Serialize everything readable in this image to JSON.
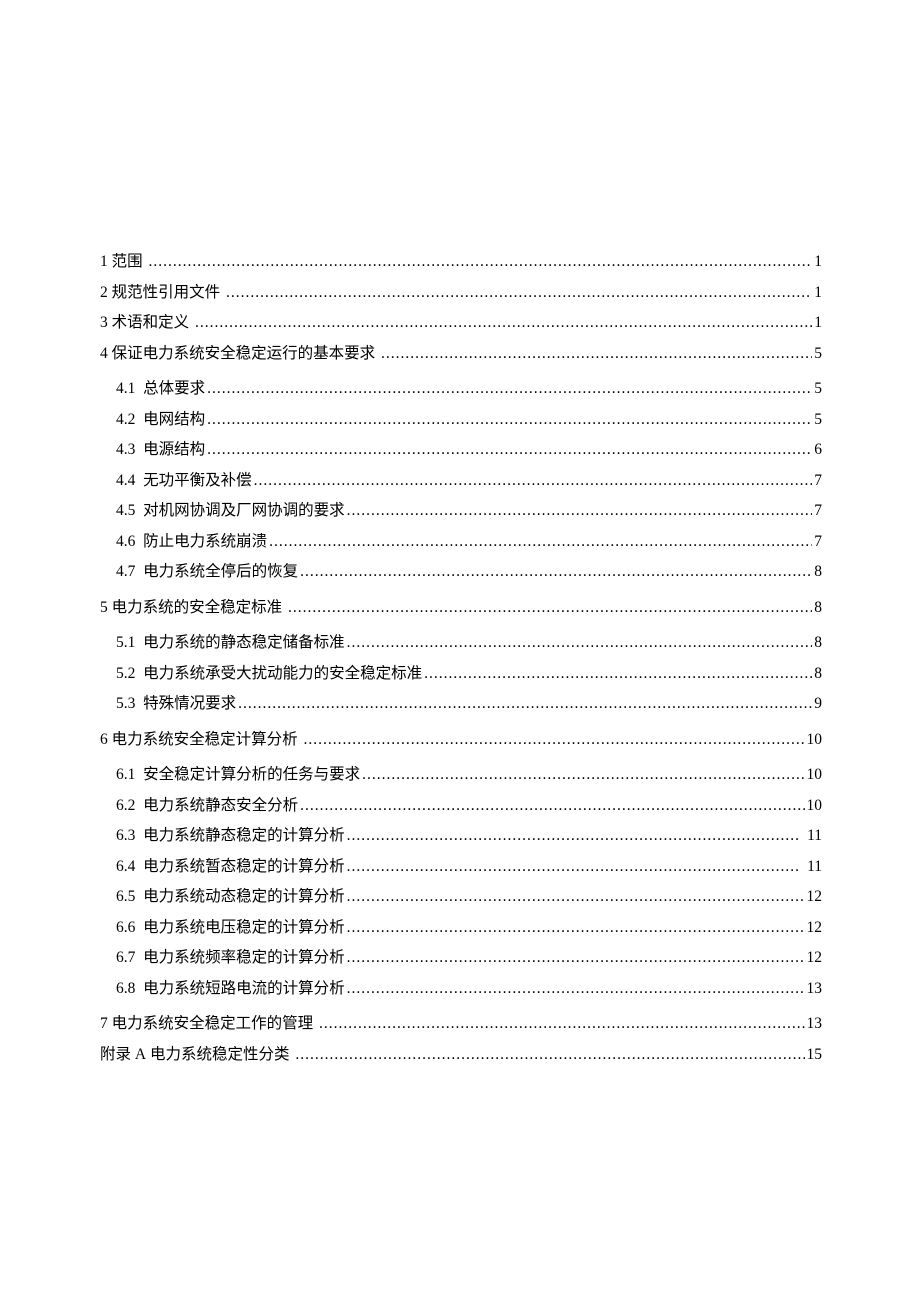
{
  "toc": [
    {
      "num": "1",
      "text": " 范围 ",
      "page": "1",
      "sub": false
    },
    {
      "num": "2",
      "text": " 规范性引用文件 ",
      "page": "1",
      "sub": false
    },
    {
      "num": "3",
      "text": " 术语和定义 ",
      "page": "1",
      "sub": false
    },
    {
      "num": "4",
      "text": " 保证电力系统安全稳定运行的基本要求 ",
      "page": "5",
      "sub": false
    },
    {
      "num": "4.1",
      "text": "  总体要求",
      "page": "5",
      "sub": true
    },
    {
      "num": "4.2",
      "text": "  电网结构",
      "page": "5",
      "sub": true
    },
    {
      "num": "4.3",
      "text": "  电源结构",
      "page": "6",
      "sub": true
    },
    {
      "num": "4.4",
      "text": "  无功平衡及补偿",
      "page": "7",
      "sub": true
    },
    {
      "num": "4.5",
      "text": "  对机网协调及厂网协调的要求",
      "page": "7",
      "sub": true
    },
    {
      "num": "4.6",
      "text": "  防止电力系统崩溃",
      "page": "7",
      "sub": true
    },
    {
      "num": "4.7",
      "text": "  电力系统全停后的恢复",
      "page": "8",
      "sub": true
    },
    {
      "num": "5",
      "text": " 电力系统的安全稳定标准 ",
      "page": "8",
      "sub": false
    },
    {
      "num": "5.1",
      "text": "  电力系统的静态稳定储备标准",
      "page": "8",
      "sub": true
    },
    {
      "num": "5.2",
      "text": "  电力系统承受大扰动能力的安全稳定标准",
      "page": "8",
      "sub": true
    },
    {
      "num": "5.3",
      "text": "  特殊情况要求",
      "page": "9",
      "sub": true
    },
    {
      "num": "6",
      "text": " 电力系统安全稳定计算分析 ",
      "page": "10",
      "sub": false
    },
    {
      "num": "6.1",
      "text": "  安全稳定计算分析的任务与要求",
      "page": "10",
      "sub": true
    },
    {
      "num": "6.2",
      "text": "  电力系统静态安全分析",
      "page": "10",
      "sub": true
    },
    {
      "num": "6.3",
      "text": "  电力系统静态稳定的计算分析",
      "page": " 11",
      "sub": true
    },
    {
      "num": "6.4",
      "text": "  电力系统暂态稳定的计算分析",
      "page": " 11",
      "sub": true
    },
    {
      "num": "6.5",
      "text": "  电力系统动态稳定的计算分析",
      "page": "12",
      "sub": true
    },
    {
      "num": "6.6",
      "text": "  电力系统电压稳定的计算分析",
      "page": "12",
      "sub": true
    },
    {
      "num": "6.7",
      "text": "  电力系统频率稳定的计算分析",
      "page": "12",
      "sub": true
    },
    {
      "num": "6.8",
      "text": "  电力系统短路电流的计算分析",
      "page": "13",
      "sub": true
    },
    {
      "num": "7",
      "text": " 电力系统安全稳定工作的管理 ",
      "page": "13",
      "sub": false
    },
    {
      "num": "附录 A",
      "text": " 电力系统稳定性分类 ",
      "page": "15",
      "sub": false
    }
  ]
}
